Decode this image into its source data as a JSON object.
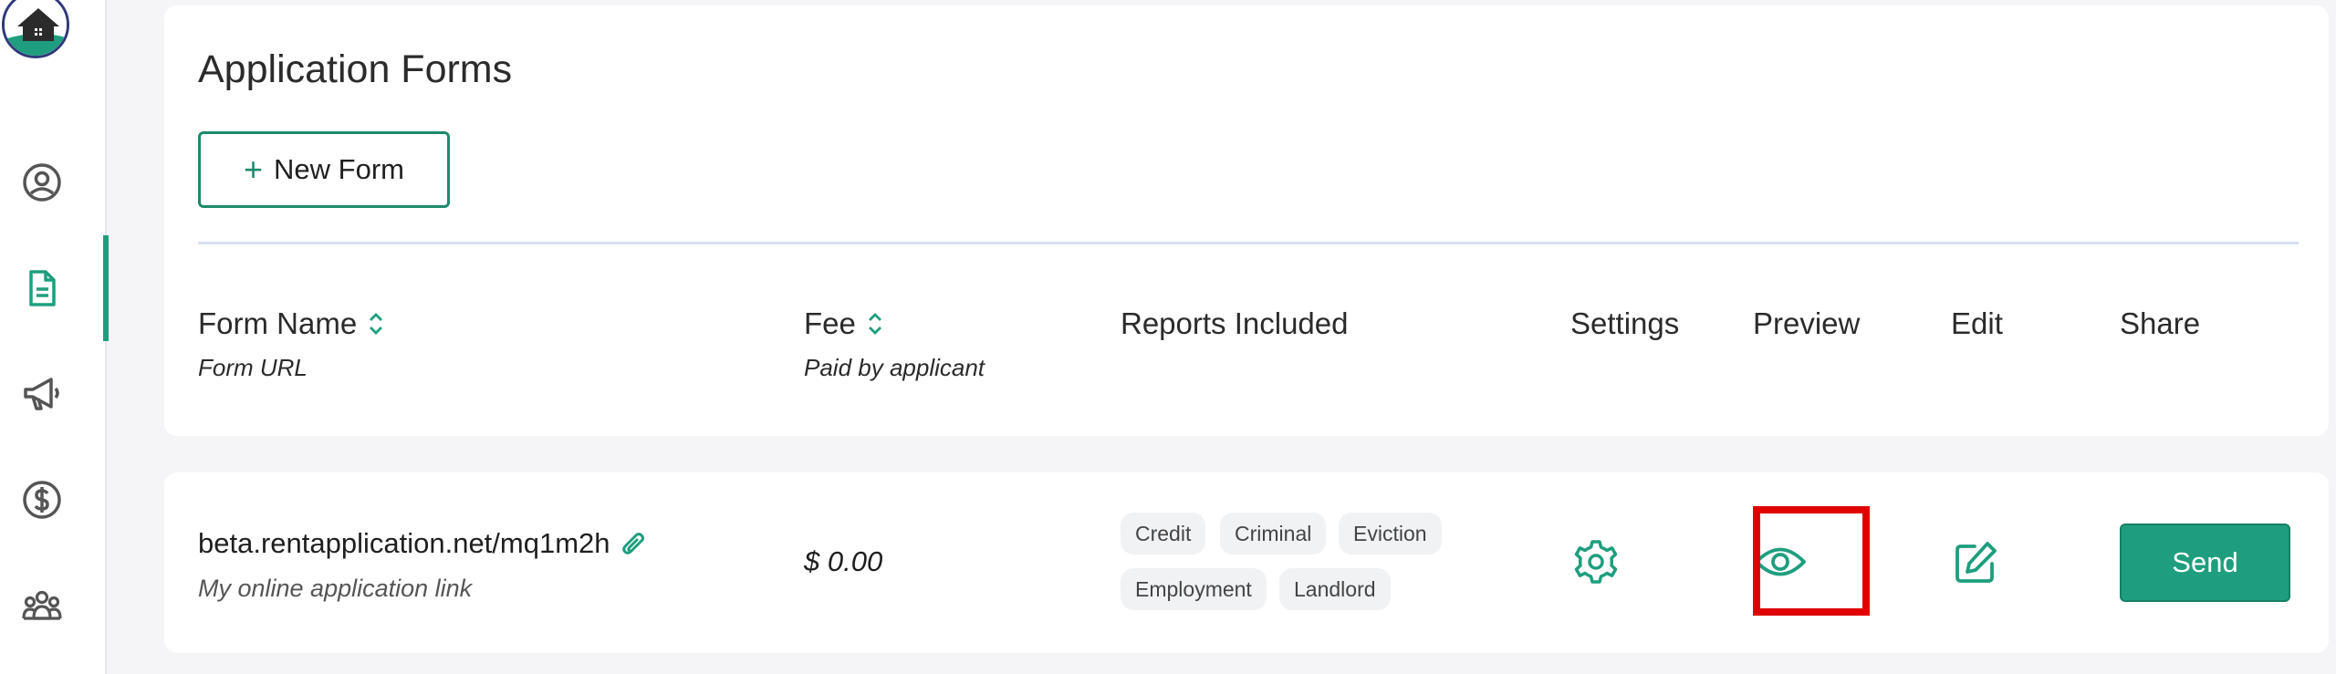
{
  "sidebar": {
    "logo": "house-logo",
    "items": [
      {
        "name": "profile",
        "icon": "user-circle-icon"
      },
      {
        "name": "forms",
        "icon": "document-icon",
        "active": true
      },
      {
        "name": "marketing",
        "icon": "megaphone-icon"
      },
      {
        "name": "payments",
        "icon": "dollar-icon"
      },
      {
        "name": "team",
        "icon": "users-group-icon"
      }
    ]
  },
  "header": {
    "title": "Application Forms",
    "new_form_label": "New Form"
  },
  "columns": {
    "form_name": {
      "label": "Form Name",
      "sub": "Form URL"
    },
    "fee": {
      "label": "Fee",
      "sub": "Paid by applicant"
    },
    "reports": {
      "label": "Reports Included"
    },
    "settings": {
      "label": "Settings"
    },
    "preview": {
      "label": "Preview"
    },
    "edit": {
      "label": "Edit"
    },
    "share": {
      "label": "Share"
    }
  },
  "rows": [
    {
      "url": "beta.rentapplication.net/mq1m2h",
      "description": "My online application link",
      "fee": "$ 0.00",
      "reports": [
        "Credit",
        "Criminal",
        "Eviction",
        "Employment",
        "Landlord"
      ],
      "send_label": "Send"
    }
  ],
  "colors": {
    "accent": "#1e9e7e",
    "highlight": "#e00000"
  }
}
